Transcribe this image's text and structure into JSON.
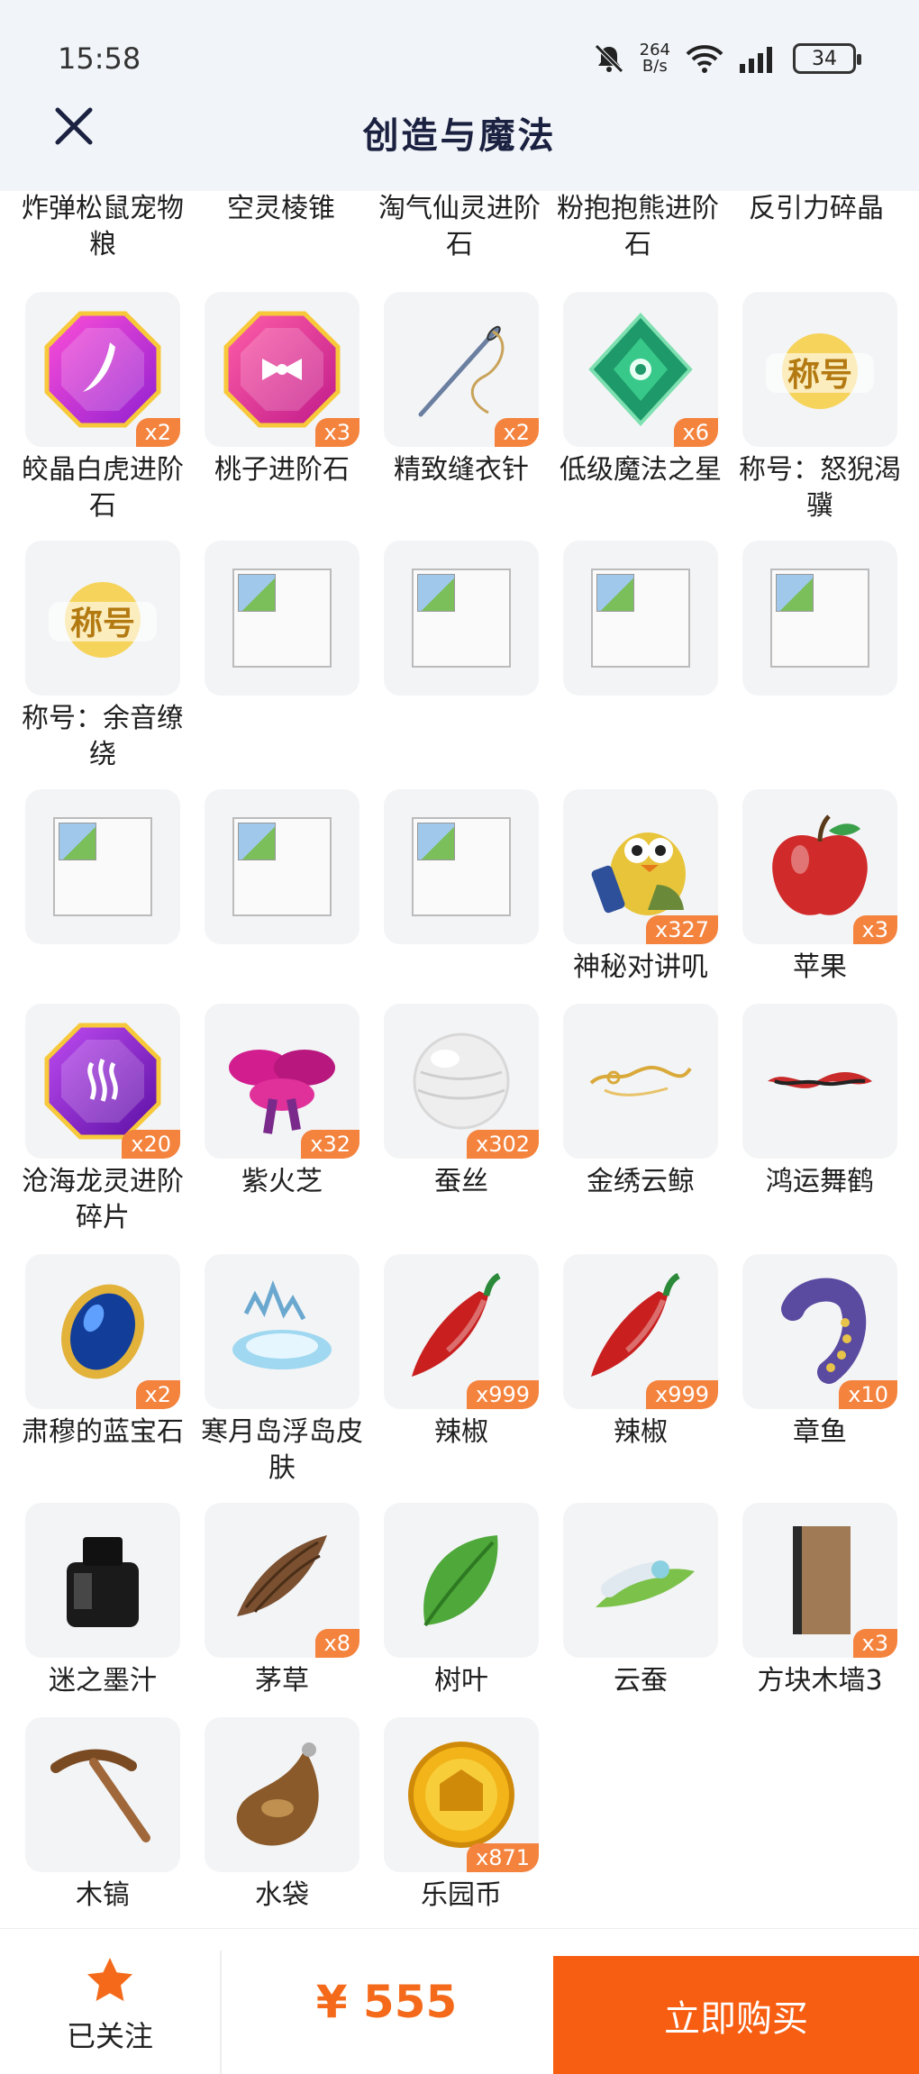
{
  "status": {
    "time": "15:58",
    "net_speed": "264",
    "net_unit": "B/s",
    "battery": "34"
  },
  "header": {
    "title": "创造与魔法"
  },
  "top_partial_items": [
    "炸弹松鼠宠物粮",
    "空灵棱锥",
    "淘气仙灵进阶石",
    "粉抱抱熊进阶石",
    "反引力碎晶"
  ],
  "items": [
    {
      "name": "皎晶白虎进阶石",
      "count": "x2",
      "icon": "pink-gem-icon"
    },
    {
      "name": "桃子进阶石",
      "count": "x3",
      "icon": "pink-bow-gem-icon"
    },
    {
      "name": "精致缝衣针",
      "count": "x2",
      "icon": "needle-icon"
    },
    {
      "name": "低级魔法之星",
      "count": "x6",
      "icon": "green-crystal-icon"
    },
    {
      "name": "称号：怒猊渴骥",
      "count": "",
      "icon": "title-badge-icon",
      "badge_text": "称号"
    },
    {
      "name": "称号：余音缭绕",
      "count": "",
      "icon": "title-badge-icon",
      "badge_text": "称号"
    },
    {
      "name": "",
      "count": "",
      "icon": "broken-image-icon"
    },
    {
      "name": "",
      "count": "",
      "icon": "broken-image-icon"
    },
    {
      "name": "",
      "count": "",
      "icon": "broken-image-icon"
    },
    {
      "name": "",
      "count": "",
      "icon": "broken-image-icon"
    },
    {
      "name": "",
      "count": "",
      "icon": "broken-image-icon"
    },
    {
      "name": "",
      "count": "",
      "icon": "broken-image-icon"
    },
    {
      "name": "",
      "count": "",
      "icon": "broken-image-icon"
    },
    {
      "name": "神秘对讲叽",
      "count": "x327",
      "icon": "walkie-bird-icon"
    },
    {
      "name": "苹果",
      "count": "x3",
      "icon": "apple-icon"
    },
    {
      "name": "沧海龙灵进阶碎片",
      "count": "x20",
      "icon": "purple-gem-icon"
    },
    {
      "name": "紫火芝",
      "count": "x32",
      "icon": "purple-mushroom-icon"
    },
    {
      "name": "蚕丝",
      "count": "x302",
      "icon": "silk-ball-icon"
    },
    {
      "name": "金绣云鲸",
      "count": "",
      "icon": "gold-whale-icon"
    },
    {
      "name": "鸿运舞鹤",
      "count": "",
      "icon": "red-crane-icon"
    },
    {
      "name": "肃穆的蓝宝石",
      "count": "x2",
      "icon": "sapphire-icon"
    },
    {
      "name": "寒月岛浮岛皮肤",
      "count": "",
      "icon": "floating-island-icon"
    },
    {
      "name": "辣椒",
      "count": "x999",
      "icon": "chili-icon"
    },
    {
      "name": "辣椒",
      "count": "x999",
      "icon": "chili-icon"
    },
    {
      "name": "章鱼",
      "count": "x10",
      "icon": "octopus-icon"
    },
    {
      "name": "迷之墨汁",
      "count": "",
      "icon": "ink-bottle-icon"
    },
    {
      "name": "茅草",
      "count": "x8",
      "icon": "thatch-icon"
    },
    {
      "name": "树叶",
      "count": "",
      "icon": "leaf-icon"
    },
    {
      "name": "云蚕",
      "count": "",
      "icon": "silkworm-icon"
    },
    {
      "name": "方块木墙3",
      "count": "x3",
      "icon": "wood-wall-icon"
    },
    {
      "name": "木镐",
      "count": "",
      "icon": "pickaxe-icon"
    },
    {
      "name": "水袋",
      "count": "",
      "icon": "water-bag-icon"
    },
    {
      "name": "乐园币",
      "count": "x871",
      "icon": "gold-coin-icon"
    }
  ],
  "bottom_bar": {
    "follow_label": "已关注",
    "price": "¥ 555",
    "buy_label": "立即购买"
  },
  "colors": {
    "accent": "#f75e12",
    "badge": "#f4833e",
    "header_bg": "#f1f4f8",
    "card_bg": "#f3f4f6"
  }
}
